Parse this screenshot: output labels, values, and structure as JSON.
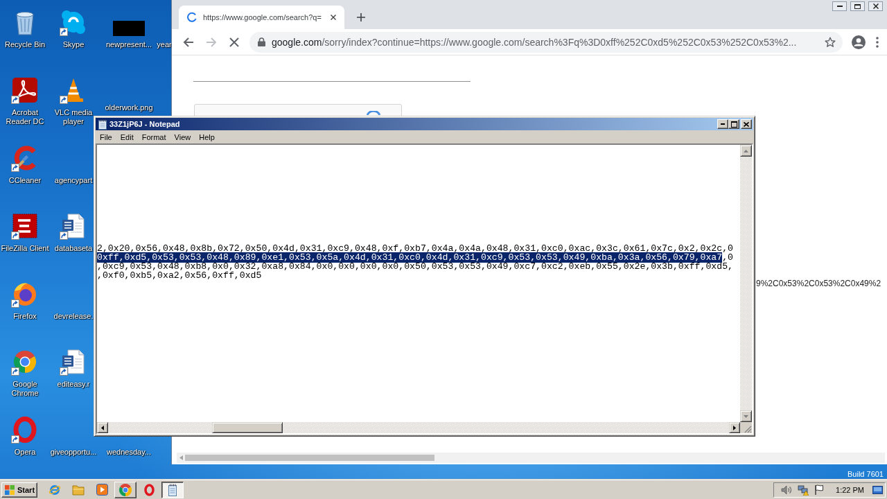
{
  "desktop": {
    "icons": [
      {
        "label": "Recycle Bin",
        "shortcut": false
      },
      {
        "label": "Acrobat Reader DC",
        "shortcut": true
      },
      {
        "label": "CCleaner",
        "shortcut": true
      },
      {
        "label": "FileZilla Client",
        "shortcut": true
      },
      {
        "label": "Firefox",
        "shortcut": true
      },
      {
        "label": "Google Chrome",
        "shortcut": true
      },
      {
        "label": "Opera",
        "shortcut": true
      },
      {
        "label": "Skype",
        "shortcut": true
      },
      {
        "label": "VLC media player",
        "shortcut": true
      },
      {
        "label": "agencypart",
        "shortcut": false
      },
      {
        "label": "databaseta",
        "shortcut": true
      },
      {
        "label": "devrelease.",
        "shortcut": false
      },
      {
        "label": "editeasy.r",
        "shortcut": true
      },
      {
        "label": "giveopportu...",
        "shortcut": false
      },
      {
        "label": "newpresent...",
        "shortcut": false
      },
      {
        "label": "olderwork.png",
        "shortcut": false
      },
      {
        "label": "wednesday...",
        "shortcut": false
      },
      {
        "label": "year",
        "shortcut": false
      }
    ],
    "build": "Build 7601"
  },
  "browser": {
    "tabs": [
      {
        "title": "https://www.google.com/search?q=",
        "selected": true,
        "loading": true
      }
    ],
    "back_disabled": false,
    "forward_disabled": true,
    "address": {
      "host": "google.com",
      "path": "/sorry/index?continue=https://www.google.com/search%3Fq%3D0xff%252C0xd5%252C0x53%252C0x53%2..."
    },
    "page_text": "9%2C0x53%2C0x53%2C0x49%2"
  },
  "notepad": {
    "title": "33Z1jP6J - Notepad",
    "menu": [
      "File",
      "Edit",
      "Format",
      "View",
      "Help"
    ],
    "lines": [
      {
        "segments": [
          {
            "text": "2,0x20,0x56,0x48,0x8b,0x72,0x50,0x4d,0x31,0xc9,0x48,0xf,0xb7,0x4a,0x4a,0x48,0x31,0xc0,0xac,0x3c,0x61,0x7c,0x2,0x2c,0",
            "selected": false
          }
        ]
      },
      {
        "segments": [
          {
            "text": "0xff,0xd5,0x53,0x53,0x48,0x89,0xe1,0x53,0x5a,0x4d,0x31,0xc0,0x4d,0x31,0xc9,0x53,0x53,0x49,0xba,0x3a,0x56,0x79,0xa7",
            "selected": true
          },
          {
            "text": ",0",
            "selected": false
          }
        ]
      },
      {
        "segments": [
          {
            "text": ",0xc9,0x53,0x48,0xb8,0x0,0x32,0xa8,0x84,0x0,0x0,0x0,0x0,0x50,0x53,0x53,0x49,0xc7,0xc2,0xeb,0x55,0x2e,0x3b,0xff,0xd5,",
            "selected": false
          }
        ]
      },
      {
        "segments": [
          {
            "text": ",0xf0,0xb5,0xa2,0x56,0xff,0xd5",
            "selected": false
          }
        ]
      }
    ]
  },
  "taskbar": {
    "start": "Start",
    "buttons": [
      {
        "running": false,
        "selected": false
      },
      {
        "running": false,
        "selected": false
      },
      {
        "running": false,
        "selected": false
      },
      {
        "running": true,
        "selected": false
      },
      {
        "running": false,
        "selected": false
      },
      {
        "running": true,
        "selected": true
      }
    ],
    "clock": "1:22 PM"
  }
}
